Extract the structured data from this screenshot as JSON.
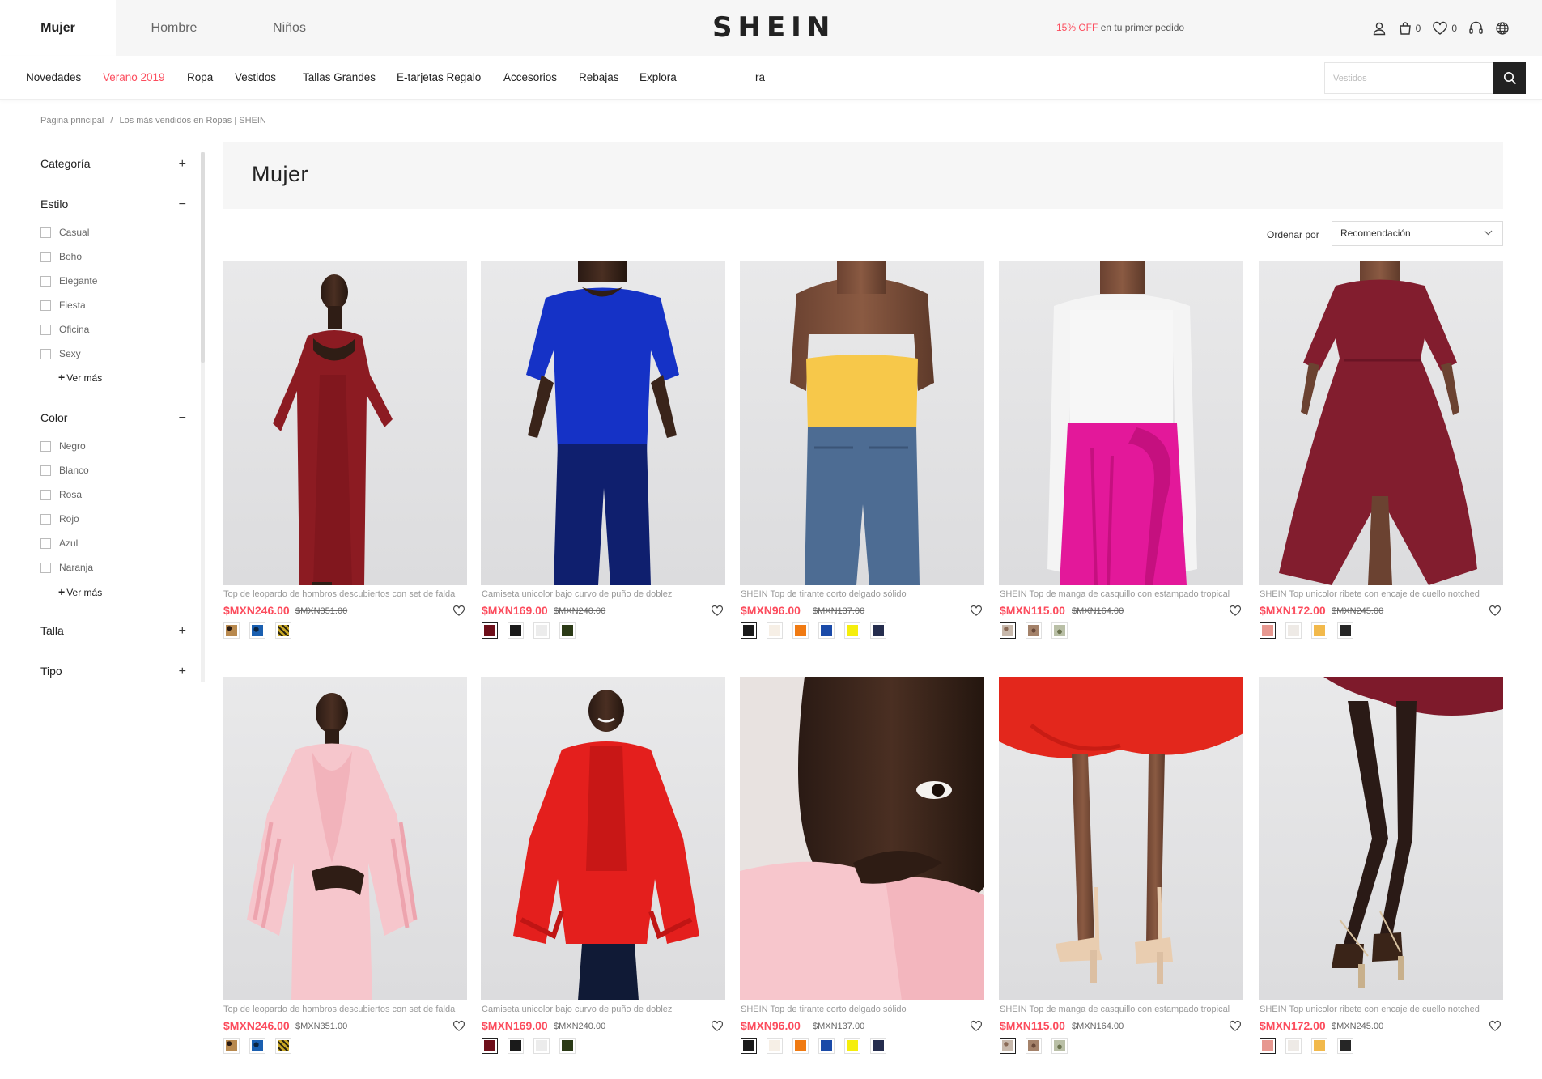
{
  "header": {
    "gender_tabs": [
      "Mujer",
      "Hombre",
      "Niños"
    ],
    "logo": "SHEIN",
    "promo_highlight": "15% OFF",
    "promo_rest": " en tu primer pedido",
    "cart_count": "0",
    "wishlist_count": "0"
  },
  "nav": {
    "items": [
      "Novedades",
      "Verano 2019",
      "Ropa",
      "Vestidos",
      "Tallas Grandes",
      "E-tarjetas Regalo",
      "Accesorios",
      "Rebajas",
      "Explora",
      "ra"
    ],
    "highlight_color": "#fc4c5d",
    "search_placeholder": "Vestidos"
  },
  "breadcrumb": {
    "home": "Página principal",
    "sep": "/",
    "current": "Los más vendidos en Ropas | SHEIN"
  },
  "sidebar": {
    "categoria": "Categoría",
    "estilo": "Estilo",
    "estilo_options": [
      "Casual",
      "Boho",
      "Elegante",
      "Fiesta",
      "Oficina",
      "Sexy"
    ],
    "ver_mas": "Ver más",
    "color": "Color",
    "color_options": [
      "Negro",
      "Blanco",
      "Rosa",
      "Rojo",
      "Azul",
      "Naranja"
    ],
    "talla": "Talla",
    "tipo": "Tipo",
    "plus": "+",
    "minus": "−"
  },
  "main": {
    "title": "Mujer",
    "sort_label": "Ordenar por",
    "sort_value": "Recomendación"
  },
  "products": [
    {
      "name": "Top de leopardo de hombros descubiertos con set de falda",
      "price": "$MXN246.00",
      "old_price": "$MXN351.00"
    },
    {
      "name": "Camiseta unicolor bajo curvo de puño de doblez",
      "price": "$MXN169.00",
      "old_price": "$MXN240.00"
    },
    {
      "name": "SHEIN Top de tirante corto delgado sólido",
      "price": "$MXN96.00",
      "old_price": "$MXN137.00"
    },
    {
      "name": "SHEIN Top de manga de casquillo con estampado tropical",
      "price": "$MXN115.00",
      "old_price": "$MXN164.00"
    },
    {
      "name": "SHEIN Top unicolor ribete con encaje de cuello notched",
      "price": "$MXN172.00",
      "old_price": "$MXN245.00"
    },
    {
      "name": "Top de leopardo de hombros descubiertos con set de falda",
      "price": "$MXN246.00",
      "old_price": "$MXN351.00"
    },
    {
      "name": "Camiseta unicolor bajo curvo de puño de doblez",
      "price": "$MXN169.00",
      "old_price": "$MXN240.00"
    },
    {
      "name": "SHEIN Top de tirante corto delgado sólido",
      "price": "$MXN96.00",
      "old_price": "$MXN137.00"
    },
    {
      "name": "SHEIN Top de manga de casquillo con estampado tropical",
      "price": "$MXN115.00",
      "old_price": "$MXN164.00"
    },
    {
      "name": "SHEIN Top unicolor ribete con encaje de cuello notched",
      "price": "$MXN172.00",
      "old_price": "$MXN245.00"
    }
  ],
  "swatch_sets": [
    [
      "#b8894e",
      "#1a5fb0",
      "#c9a826"
    ],
    [
      "#6e0f1a",
      "#1a1a1a",
      "#ececec",
      "#2b3a16"
    ],
    [
      "#1a1a1a",
      "#f6efe6",
      "#f07a12",
      "#1a4aa8",
      "#f5ee0c",
      "#252d4e"
    ],
    [
      "#c8b9ac",
      "#a4826a",
      "#b9bfa6"
    ],
    [
      "#e79890",
      "#eeeae6",
      "#f2b94b",
      "#262626"
    ]
  ],
  "colors": {
    "accent": "#fc4c5d",
    "text": "#222222"
  }
}
